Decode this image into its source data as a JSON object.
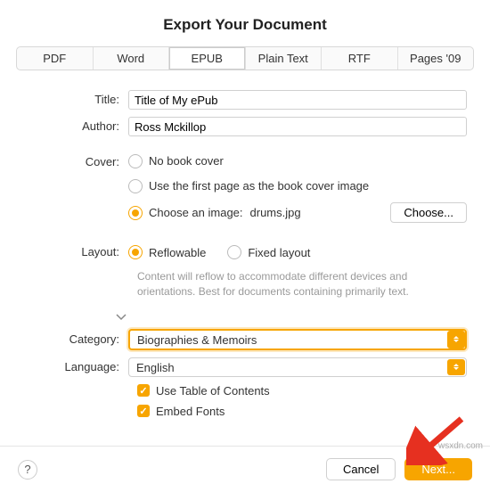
{
  "dialog": {
    "title": "Export Your Document"
  },
  "tabs": {
    "pdf": "PDF",
    "word": "Word",
    "epub": "EPUB",
    "plainText": "Plain Text",
    "rtf": "RTF",
    "pages09": "Pages '09"
  },
  "labels": {
    "title": "Title:",
    "author": "Author:",
    "cover": "Cover:",
    "layout": "Layout:",
    "category": "Category:",
    "language": "Language:"
  },
  "fields": {
    "titleValue": "Title of My ePub",
    "authorValue": "Ross Mckillop"
  },
  "cover": {
    "noCover": "No book cover",
    "firstPage": "Use the first page as the book cover image",
    "chooseImage": "Choose an image:",
    "imageFile": "drums.jpg",
    "chooseBtn": "Choose..."
  },
  "layout": {
    "reflowable": "Reflowable",
    "fixed": "Fixed layout",
    "hint": "Content will reflow to accommodate different devices and orientations. Best for documents containing primarily text."
  },
  "category": {
    "value": "Biographies & Memoirs"
  },
  "language": {
    "value": "English"
  },
  "options": {
    "toc": "Use Table of Contents",
    "embedFonts": "Embed Fonts"
  },
  "footer": {
    "help": "?",
    "cancel": "Cancel",
    "next": "Next..."
  },
  "watermark": "wsxdn.com"
}
